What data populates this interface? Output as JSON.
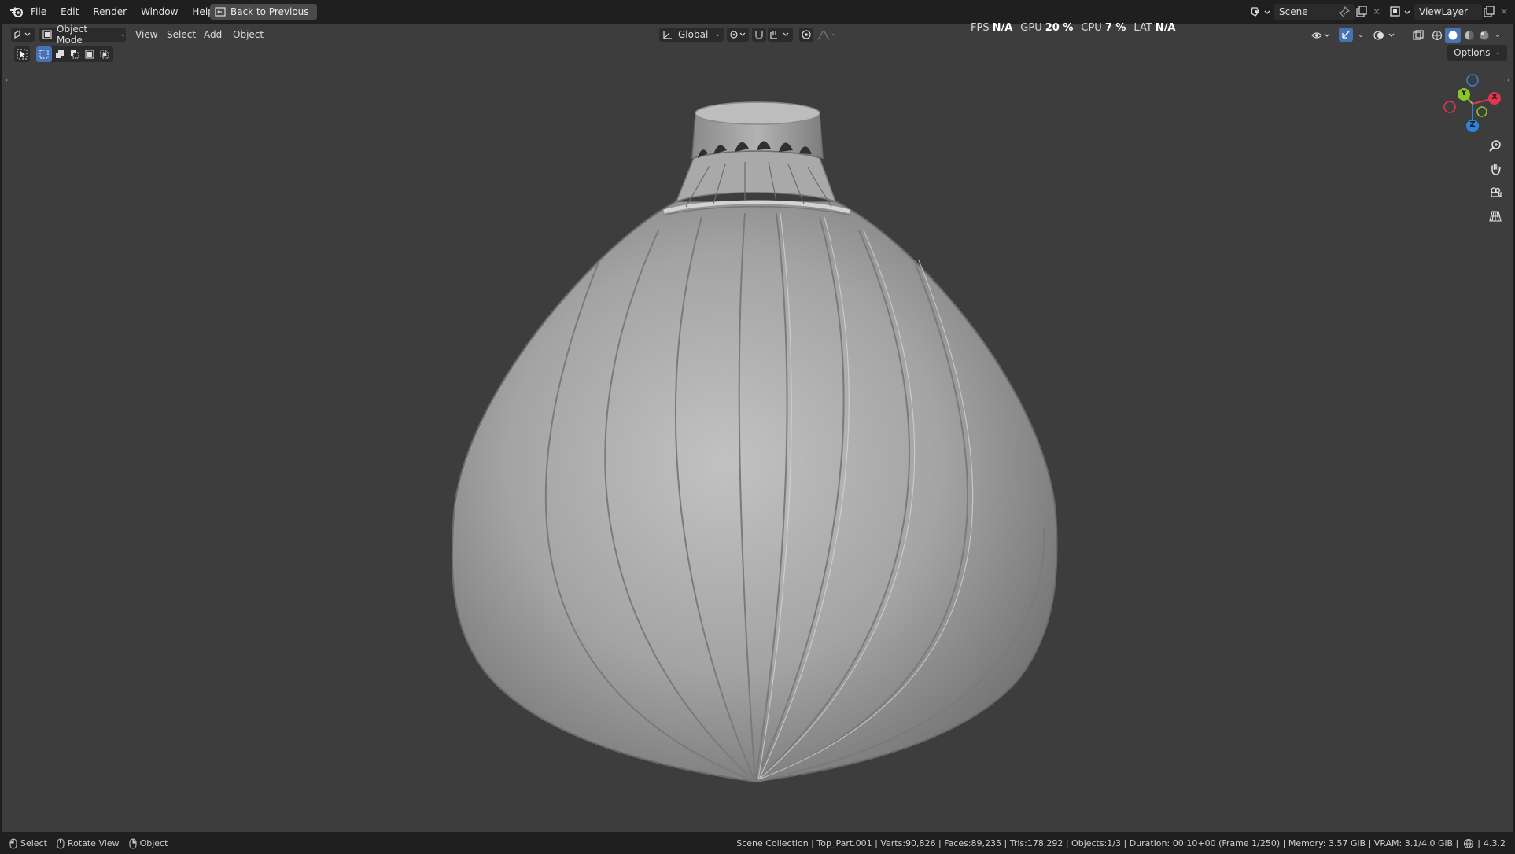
{
  "menu": {
    "items": [
      "File",
      "Edit",
      "Render",
      "Window",
      "Help"
    ],
    "back_label": "Back to Previous"
  },
  "scene": {
    "name": "Scene",
    "view_layer": "ViewLayer"
  },
  "header": {
    "mode": "Object Mode",
    "menus": [
      "View",
      "Select",
      "Add",
      "Object"
    ],
    "orientation": "Global",
    "options_label": "Options"
  },
  "perf": {
    "fps_label": "FPS",
    "fps_value": "N/A",
    "gpu_label": "GPU",
    "gpu_value": "20 %",
    "cpu_label": "CPU",
    "cpu_value": "7 %",
    "lat_label": "LAT",
    "lat_value": "N/A"
  },
  "gizmo": {
    "y": "Y",
    "x": "X",
    "z": "Z"
  },
  "status": {
    "hint_select": "Select",
    "hint_rotate": "Rotate View",
    "hint_object": "Object",
    "info": "Scene Collection | Top_Part.001 | Verts:90,826 | Faces:89,235 | Tris:178,292 | Objects:1/3 | Duration: 00:10+00 (Frame 1/250) | Memory: 3.57 GiB | VRAM: 3.1/4.0 GiB |",
    "version": "4.3.2"
  },
  "colors": {
    "viewport_bg": "#3d3d3d",
    "accent": "#4772b3",
    "axis_x": "#e0374f",
    "axis_y": "#8bc528",
    "axis_z": "#2f85dc"
  }
}
